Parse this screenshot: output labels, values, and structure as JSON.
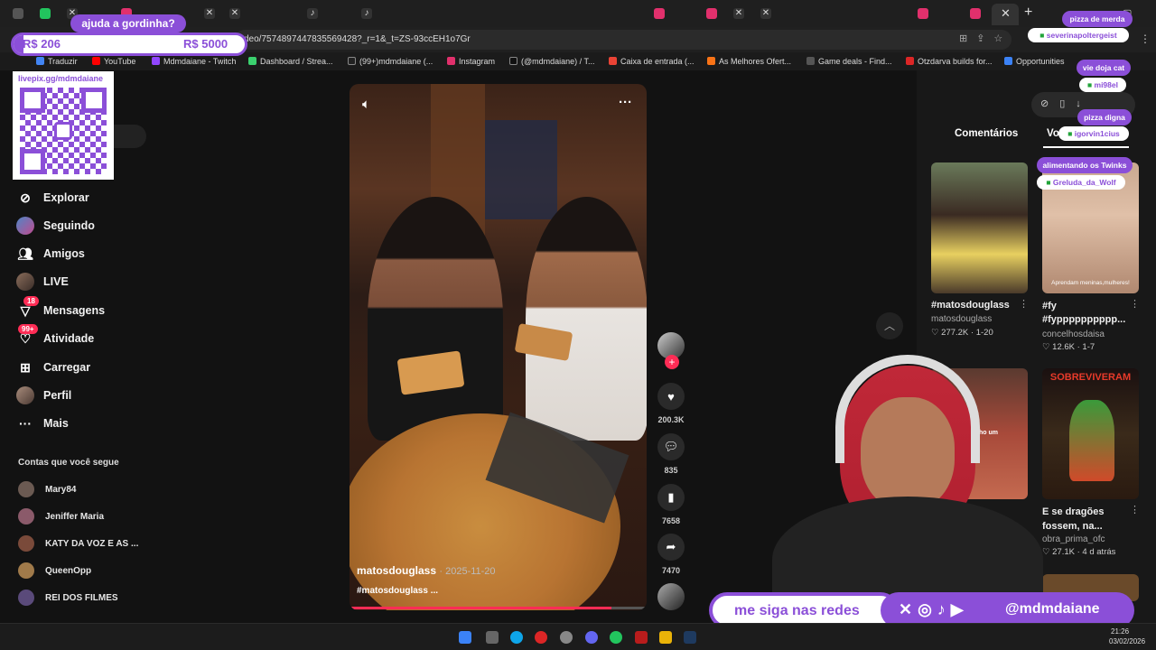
{
  "browser": {
    "url": "deo/7574897447835569428?_r=1&_t=ZS-93ccEH1o7Gr",
    "bookmarks": [
      "Traduzir",
      "YouTube",
      "Mdmdaiane - Twitch",
      "Dashboard / Strea...",
      "(99+)mdmdaiane (...",
      "Instagram",
      "(@mdmdaiane) / T...",
      "Caixa de entrada (...",
      "As Melhores Ofert...",
      "Game deals - Find...",
      "Otzdarva builds for...",
      "Opportunities"
    ]
  },
  "sidebar": {
    "search_placeholder": "a",
    "nav": [
      {
        "label": "Explorar",
        "icon": "compass-icon"
      },
      {
        "label": "Seguindo",
        "icon": "following-avatar-icon"
      },
      {
        "label": "Amigos",
        "icon": "friends-icon"
      },
      {
        "label": "LIVE",
        "icon": "live-icon"
      },
      {
        "label": "Mensagens",
        "icon": "message-icon",
        "badge": "18"
      },
      {
        "label": "Atividade",
        "icon": "activity-icon",
        "badge": "99+"
      },
      {
        "label": "Carregar",
        "icon": "upload-icon"
      },
      {
        "label": "Perfil",
        "icon": "profile-icon"
      },
      {
        "label": "Mais",
        "icon": "more-icon"
      }
    ],
    "following_title": "Contas que você segue",
    "following": [
      "Mary84",
      "Jeniffer Maria",
      "KATY DA VOZ E AS ...",
      "QueenOpp",
      "REI DOS FILMES"
    ]
  },
  "video": {
    "author": "matosdouglass",
    "date": "· 2025-11-20",
    "caption": "#matosdouglass ...",
    "likes": "200.3K",
    "comments": "835",
    "saves": "7658",
    "shares": "7470"
  },
  "panel": {
    "tabs": [
      "Comentários",
      "Vo"
    ],
    "items": [
      {
        "title": "#matosdouglass",
        "author": "matosdouglass",
        "stats": "♡ 277.2K · 1-20"
      },
      {
        "title": "#fy #fypppppppppp...",
        "author": "concelhosdaisa",
        "stats": "♡ 12.6K · 1-7",
        "thumb_caption": "Aprendam meninas,mulheres!"
      },
      {
        "title": "",
        "author": "",
        "stats": "",
        "thumb_caption": "Se tenho um"
      },
      {
        "title": "E se dragões fossem, na...",
        "author": "obra_prima_ofc",
        "stats": "♡ 27.1K · 4 d atrás",
        "thumb_caption": "SOBREVIVERAM"
      }
    ]
  },
  "stream": {
    "donation_label": "ajuda a gordinha?",
    "donation_current": "R$ 206",
    "donation_goal": "R$ 5000",
    "pix_link": "livepix.gg/mdmdaiane",
    "follow_banner": "me siga nas redes",
    "handle": "@mdmdaiane",
    "chat": [
      {
        "msg": "pizza de merda",
        "user": "severinapoltergeist"
      },
      {
        "msg": "vie doja cat",
        "user": "mi98el"
      },
      {
        "msg": "pizza digna",
        "user": "igorvin1cius"
      },
      {
        "msg": "alimentando os Twinks",
        "user": "Greluda_da_Wolf"
      }
    ]
  },
  "taskbar": {
    "time": "21:26",
    "date": "03/02/2026"
  }
}
